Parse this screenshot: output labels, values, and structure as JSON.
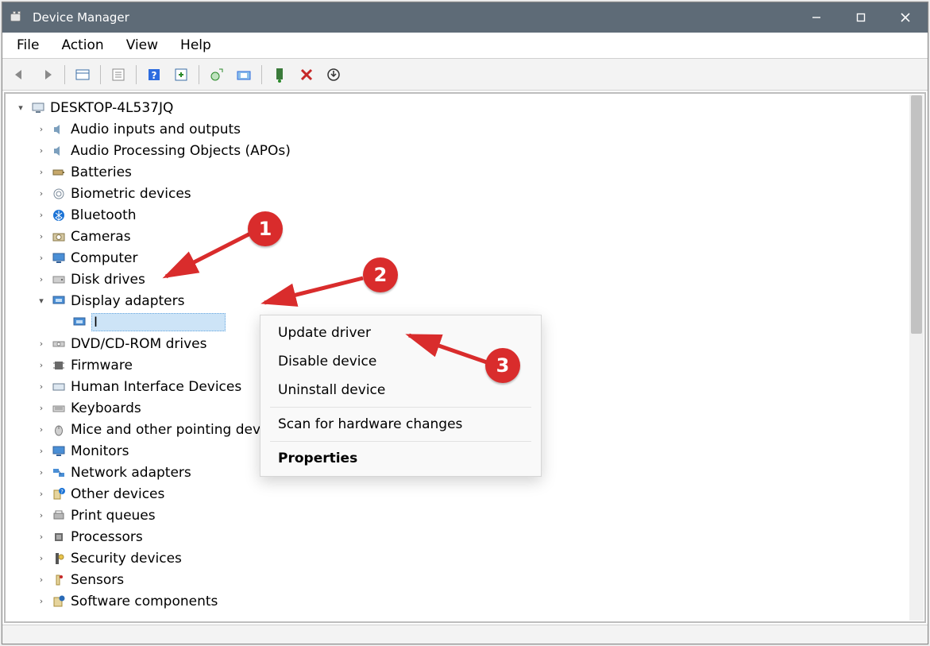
{
  "window": {
    "title": "Device Manager"
  },
  "menus": {
    "file": "File",
    "action": "Action",
    "view": "View",
    "help": "Help"
  },
  "tree": {
    "root": "DESKTOP-4L537JQ",
    "items": [
      "Audio inputs and outputs",
      "Audio Processing Objects (APOs)",
      "Batteries",
      "Biometric devices",
      "Bluetooth",
      "Cameras",
      "Computer",
      "Disk drives",
      "Display adapters",
      "DVD/CD-ROM drives",
      "Firmware",
      "Human Interface Devices",
      "Keyboards",
      "Mice and other pointing devices",
      "Monitors",
      "Network adapters",
      "Other devices",
      "Print queues",
      "Processors",
      "Security devices",
      "Sensors",
      "Software components"
    ],
    "selected_label": "I"
  },
  "context_menu": {
    "update": "Update driver",
    "disable": "Disable device",
    "uninstall": "Uninstall device",
    "scan": "Scan for hardware changes",
    "properties": "Properties"
  },
  "annotations": {
    "m1": "1",
    "m2": "2",
    "m3": "3"
  }
}
